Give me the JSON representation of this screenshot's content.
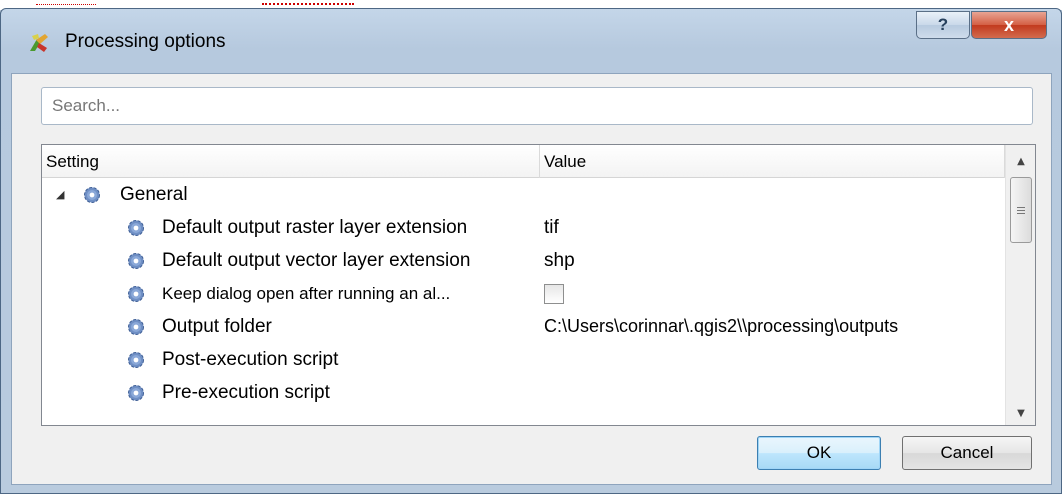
{
  "window": {
    "title": "Processing options",
    "help_label": "?",
    "close_label": "x"
  },
  "search": {
    "placeholder": "Search..."
  },
  "tree": {
    "columns": {
      "setting": "Setting",
      "value": "Value"
    },
    "rows": [
      {
        "label": "General",
        "value": "",
        "type": "group",
        "expanded": true,
        "expander": "◢"
      },
      {
        "label": "Default output raster layer extension",
        "value": "tif",
        "type": "text"
      },
      {
        "label": "Default output vector layer extension",
        "value": "shp",
        "type": "text"
      },
      {
        "label": "Keep dialog open after running an al...",
        "value": "",
        "type": "checkbox",
        "checked": false
      },
      {
        "label": "Output folder",
        "value": "C:\\Users\\corinnar\\.qgis2\\\\processing\\outputs",
        "type": "text"
      },
      {
        "label": "Post-execution script",
        "value": "",
        "type": "text"
      },
      {
        "label": "Pre-execution script",
        "value": "",
        "type": "text"
      },
      {
        "label": "",
        "value": "",
        "type": "checkbox",
        "checked": false,
        "partially_visible": true
      }
    ]
  },
  "scrollbar": {
    "up_arrow": "▲",
    "down_arrow": "▼"
  },
  "buttons": {
    "ok": "OK",
    "cancel": "Cancel"
  },
  "icons": {
    "app": "qgis-processing-icon",
    "row": "gear-icon"
  }
}
